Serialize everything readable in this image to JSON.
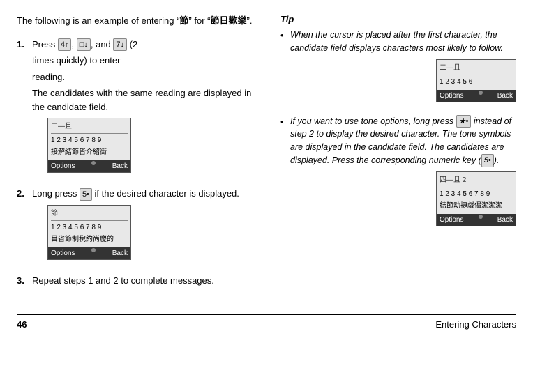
{
  "page": {
    "intro": "The following is an example of entering “",
    "intro_char": "節",
    "intro_end": "” for “",
    "intro_word": "節日歡樂",
    "intro_word_end": "”.",
    "step1_label": "1.",
    "step1_text1": "Press",
    "step1_key1": "4↑",
    "step1_comma": ",",
    "step1_key2": "□↓",
    "step1_and": ", and",
    "step1_key3": "7↓",
    "step1_times": "(2",
    "step1_times2": "times quickly) to enter",
    "step1_times3": "reading.",
    "step1_sub": "The candidates with the same reading are displayed in the candidate field.",
    "step2_label": "2.",
    "step2_text": "Long press",
    "step2_key": "5•",
    "step2_text2": "if the desired character is displayed.",
    "step3_label": "3.",
    "step3_text": "Repeat steps 1 and 2 to complete messages.",
    "screen1": {
      "top": "二—且",
      "chars": "1 2 3 4 5 6 7 8 9",
      "words": "接解結節皆介紹街",
      "bar_left": "Options",
      "bar_right": "Back"
    },
    "screen_jie": {
      "char": "節",
      "chars": "1 2 3 4 5 6 7 8 9",
      "words": "目省節制稅約尚慶的",
      "bar_left": "Options",
      "bar_right": "Back"
    },
    "tip_title": "Tip",
    "tip1_text": "When the cursor is placed after the first character, the candidate field displays characters most likely to follow.",
    "tip2_text_before": "If you want to use tone options, long press",
    "tip2_key": "★•",
    "tip2_text_after": "instead of step 2 to display the desired character. The tone symbols are displayed in the candidate field. The candidates are displayed. Press the corresponding numeric key (",
    "tip2_key2": "5•",
    "tip2_text_end": ").",
    "screen_tip1": {
      "top": "二—且",
      "chars": "1 2 3 4 5 6",
      "bar_left": "Options",
      "bar_right": "Back"
    },
    "screen_tip2": {
      "top": "四—且 2",
      "chars": "1 2 3 4 5 6 7 8 9",
      "words": "結節动捷戯偈潔潔潔",
      "bar_left": "Options",
      "bar_right": "Back"
    },
    "footer": {
      "page_number": "46",
      "chapter": "Entering Characters"
    }
  }
}
